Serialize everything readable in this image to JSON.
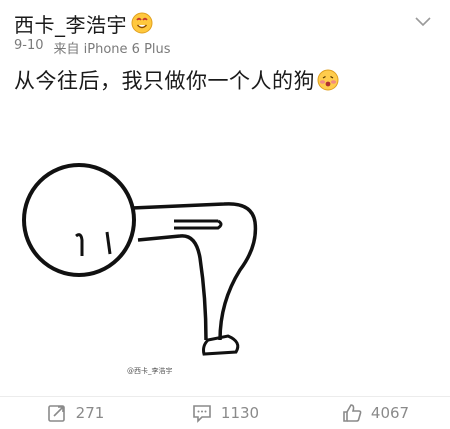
{
  "post": {
    "author": "西卡_李浩宇",
    "timestamp": "9-10",
    "source": "来自 iPhone 6 Plus",
    "text": "从今往后，我只做你一个人的狗",
    "badge_icon": "smiling-face-badge-icon",
    "text_emoji_icon": "blushing-face-emoji-icon",
    "image": {
      "description_icon": "stick-figure-bowing-drawing",
      "watermark": "@西卡_李浩宇"
    }
  },
  "actions": {
    "repost": {
      "icon": "repost-icon",
      "count": "271"
    },
    "comment": {
      "icon": "comment-icon",
      "count": "1130"
    },
    "like": {
      "icon": "thumbs-up-icon",
      "count": "4067"
    }
  },
  "colors": {
    "text": "#1a1a1a",
    "meta": "#7a7a7a",
    "action": "#8a8a8a",
    "divider": "#ececec"
  }
}
